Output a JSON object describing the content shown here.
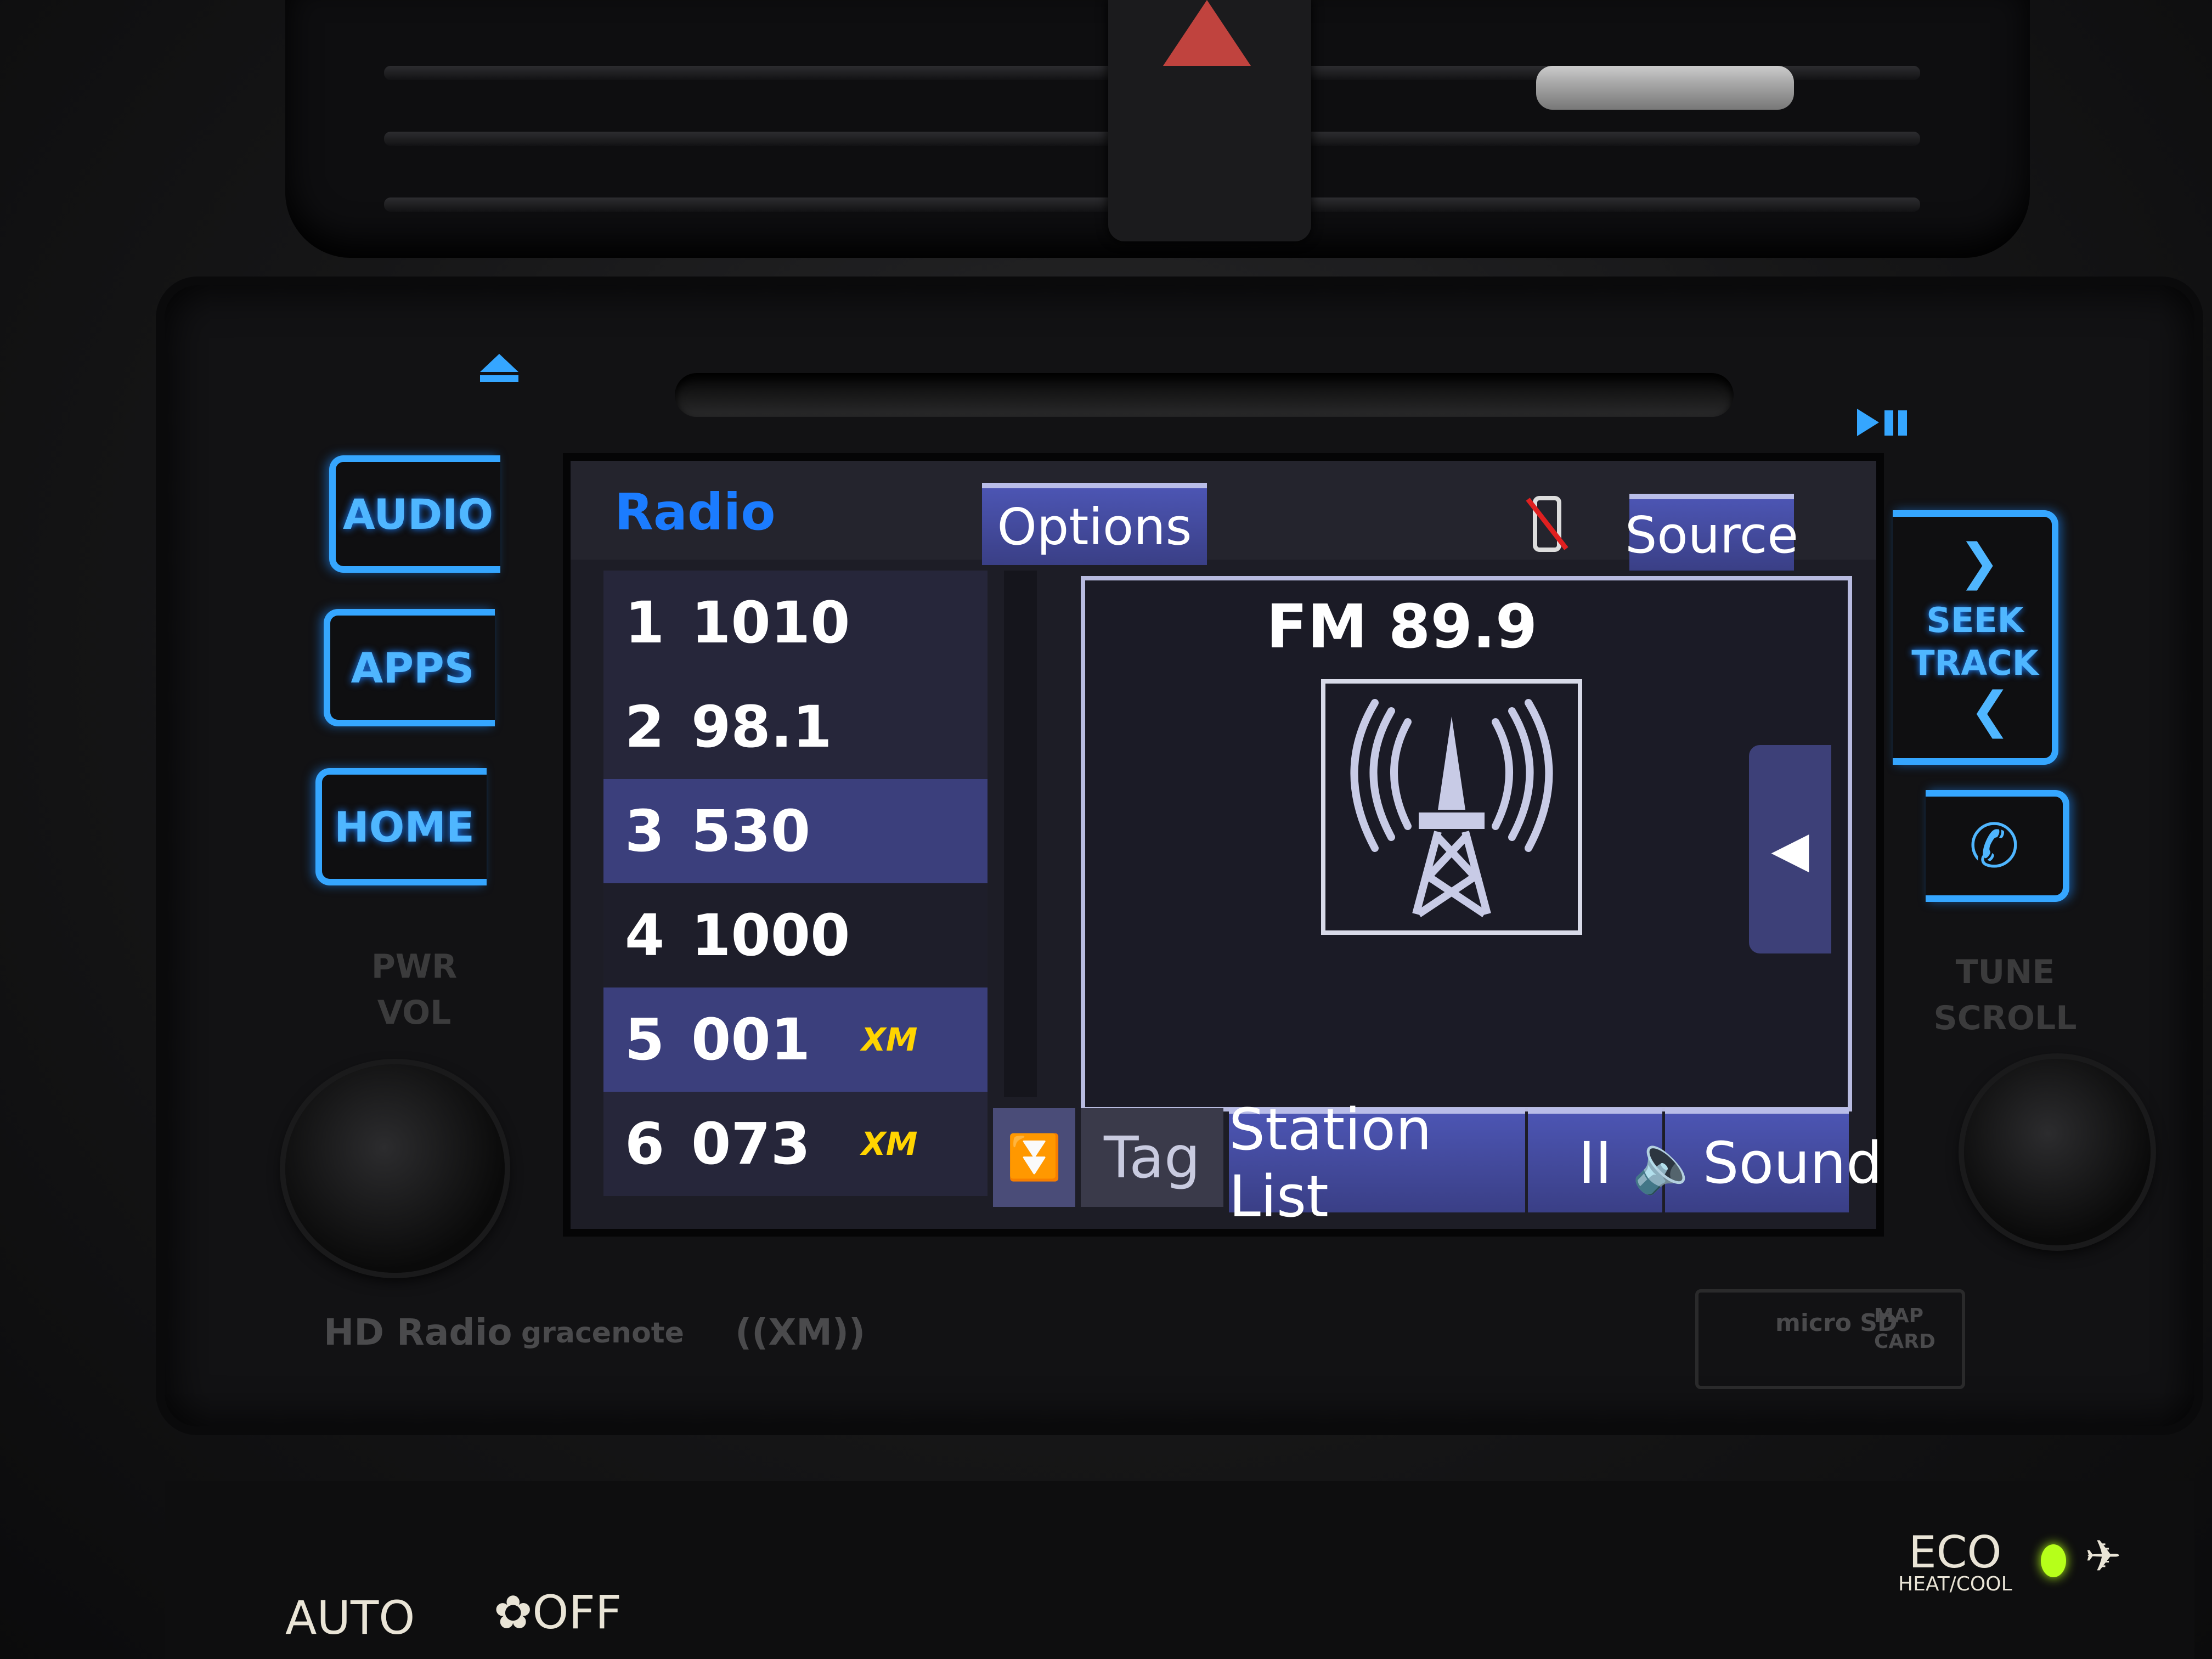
{
  "head_unit": {
    "eject_label": "eject",
    "play_pause_label": "play-pause",
    "left_buttons": [
      {
        "label": "AUDIO"
      },
      {
        "label": "APPS"
      },
      {
        "label": "HOME"
      }
    ],
    "pwr_vol_label": [
      "PWR",
      "VOL"
    ],
    "seek_track_label": [
      "SEEK",
      "TRACK"
    ],
    "tune_scroll_label": [
      "TUNE",
      "SCROLL"
    ],
    "logos": {
      "hd_radio": "HD Radio",
      "gracenote": "gracenote",
      "sxm": "((XM))"
    },
    "card_slot": {
      "micro_sd": "micro SD",
      "label_lines": [
        "MAP",
        "CARD"
      ]
    }
  },
  "screen": {
    "title": "Radio",
    "options_label": "Options",
    "source_label": "Source",
    "phone_status_icon": "phone-disconnected-icon",
    "presets": [
      {
        "num": "1",
        "freq": "1010",
        "badge": "",
        "selected": false
      },
      {
        "num": "2",
        "freq": "98.1",
        "badge": "",
        "selected": false
      },
      {
        "num": "3",
        "freq": "530",
        "badge": "",
        "selected": true
      },
      {
        "num": "4",
        "freq": "1000",
        "badge": "",
        "selected": false
      },
      {
        "num": "5",
        "freq": "001",
        "badge": "XM",
        "selected": true
      },
      {
        "num": "6",
        "freq": "073",
        "badge": "XM",
        "selected": false
      }
    ],
    "now_playing": {
      "station": "FM 89.9",
      "artwork_icon": "radio-tower-icon"
    },
    "bottom_bar": {
      "tag_label": "Tag",
      "station_list_label": "Station List",
      "pause_label": "II",
      "sound_label": "Sound"
    }
  },
  "climate": {
    "auto_label": "AUTO",
    "fan_off_label": "OFF",
    "eco_label": "ECO",
    "eco_sub_label": "HEAT/COOL",
    "seatbelt_indicator": "on"
  },
  "colors": {
    "accent_blue": "#1b7cff",
    "backlight": "#35a6ff",
    "xm_yellow": "#ffd400",
    "indicator_green": "#b6ff1a"
  }
}
